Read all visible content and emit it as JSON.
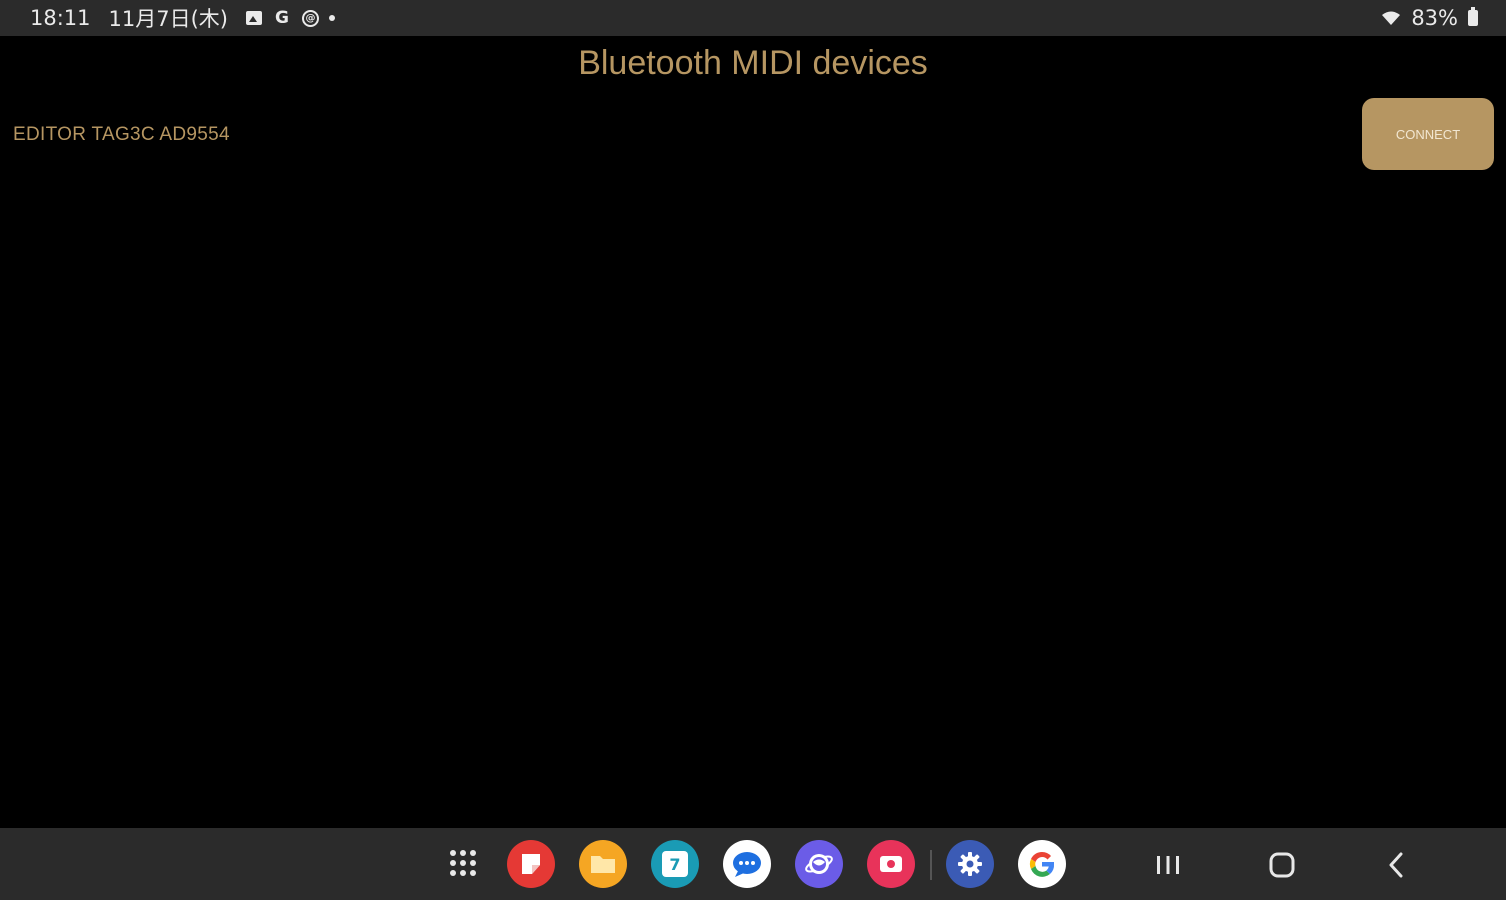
{
  "status_bar": {
    "time": "18:11",
    "date": "11月7日(木)",
    "notification_icons": [
      "gallery-icon",
      "google-icon",
      "at-sign-icon",
      "dot-icon"
    ],
    "battery_level": "83%",
    "status_icons": [
      "wifi-icon",
      "battery-icon"
    ]
  },
  "app": {
    "title": "Bluetooth MIDI devices",
    "devices": [
      {
        "name": "EDITOR TAG3C AD9554",
        "action_label": "CONNECT"
      }
    ]
  },
  "taskbar": {
    "apps": [
      {
        "name": "apps-grid-icon"
      },
      {
        "name": "notes-app-icon",
        "color": "#e53935"
      },
      {
        "name": "files-app-icon",
        "color": "#f5a623"
      },
      {
        "name": "calendar-app-icon",
        "color": "#1a9bb5"
      },
      {
        "name": "messages-app-icon",
        "color": "#1e6fe0"
      },
      {
        "name": "internet-app-icon",
        "color": "#6b5ce7"
      },
      {
        "name": "screen-recorder-app-icon",
        "color": "#e8335a"
      },
      {
        "name": "settings-app-icon",
        "color": "#3b5bb5"
      },
      {
        "name": "google-app-icon",
        "color": "#ffffff"
      }
    ],
    "nav": [
      "recents-icon",
      "home-icon",
      "back-icon"
    ],
    "calendar_day": "7"
  },
  "colors": {
    "accent": "#b69662",
    "background": "#000000",
    "bar": "#2b2b2b"
  }
}
